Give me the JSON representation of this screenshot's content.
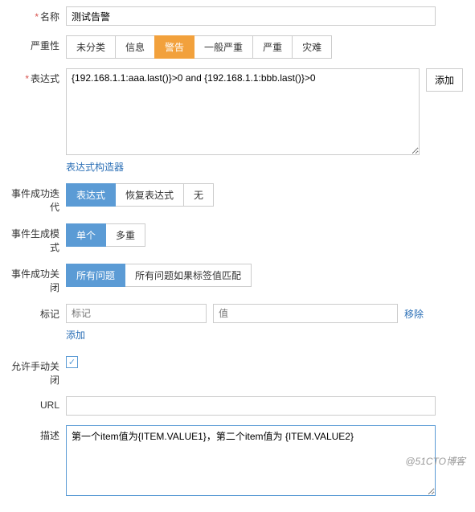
{
  "name": {
    "label": "名称",
    "value": "测试告警"
  },
  "severity": {
    "label": "严重性",
    "options": [
      "未分类",
      "信息",
      "警告",
      "一般严重",
      "严重",
      "灾难"
    ],
    "selected": "警告"
  },
  "expression": {
    "label": "表达式",
    "value": "{192.168.1.1:aaa.last()}>0 and {192.168.1.1:bbb.last()}>0",
    "add_btn": "添加",
    "constructor_link": "表达式构造器"
  },
  "ok_event_iter": {
    "label": "事件成功迭代",
    "options": [
      "表达式",
      "恢复表达式",
      "无"
    ],
    "selected": "表达式"
  },
  "event_gen_mode": {
    "label": "事件生成模式",
    "options": [
      "单个",
      "多重"
    ],
    "selected": "单个"
  },
  "ok_event_close": {
    "label": "事件成功关闭",
    "options": [
      "所有问题",
      "所有问题如果标签值匹配"
    ],
    "selected": "所有问题"
  },
  "tags": {
    "label": "标记",
    "name_placeholder": "标记",
    "value_placeholder": "值",
    "remove": "移除",
    "add": "添加"
  },
  "allow_manual_close": {
    "label": "允许手动关闭",
    "checked": true
  },
  "url": {
    "label": "URL",
    "value": ""
  },
  "description": {
    "label": "描述",
    "value": "第一个item值为{ITEM.VALUE1}，第二个item值为 {ITEM.VALUE2}"
  },
  "watermark": "@51CTO博客"
}
